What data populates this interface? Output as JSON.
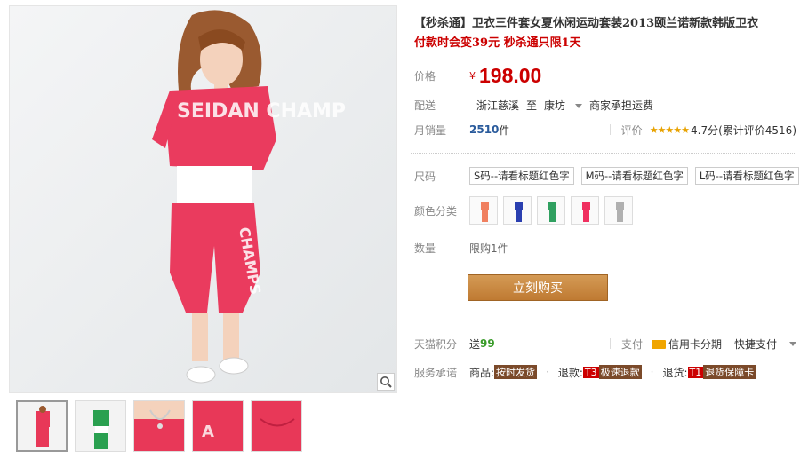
{
  "product": {
    "title": "【秒杀通】卫衣三件套女夏休闲运动套装2013颐兰诺新款韩版卫衣",
    "subtitle": "付款时会变39元 秒杀通只限1天",
    "image_text_top": "SEIDAN CHAMP",
    "image_text_pants": "CHAMPS"
  },
  "price": {
    "label": "价格",
    "currency": "¥",
    "value": "198.00"
  },
  "shipping": {
    "label": "配送",
    "from": "浙江慈溪",
    "to_word": "至",
    "to": "康坊",
    "fee": "商家承担运费"
  },
  "sales": {
    "label": "月销量",
    "count": "2510",
    "unit": "件",
    "rating_label": "评价",
    "stars": "★★★★★",
    "score": "4.7分",
    "total": "(累计评价4516)"
  },
  "sku": {
    "size_label": "尺码",
    "sizes": [
      "S码--请看标题红色字",
      "M码--请看标题红色字",
      "L码--请看标题红色字"
    ],
    "color_label": "颜色分类",
    "colors": [
      "#f08060",
      "#2a3fb0",
      "#30a060",
      "#f03060",
      "#b0b0b0"
    ]
  },
  "quantity": {
    "label": "数量",
    "limit": "限购1件"
  },
  "buy_button": "立刻购买",
  "points": {
    "label": "天猫积分",
    "prefix": "送",
    "value": "99",
    "pay_label": "支付",
    "credit": "信用卡分期",
    "quick_pay": "快捷支付"
  },
  "service": {
    "label": "服务承诺",
    "item1_prefix": "商品:",
    "item1": "按时发货",
    "item2_prefix": "退款:",
    "item2_badge": "T3",
    "item2": "极速退款",
    "item3_prefix": "退货:",
    "item3_badge": "T1",
    "item3": "退货保障卡"
  },
  "thumbnails": [
    "#e83858",
    "#2aa050",
    "#e83858",
    "#e83858",
    "#e83858"
  ]
}
